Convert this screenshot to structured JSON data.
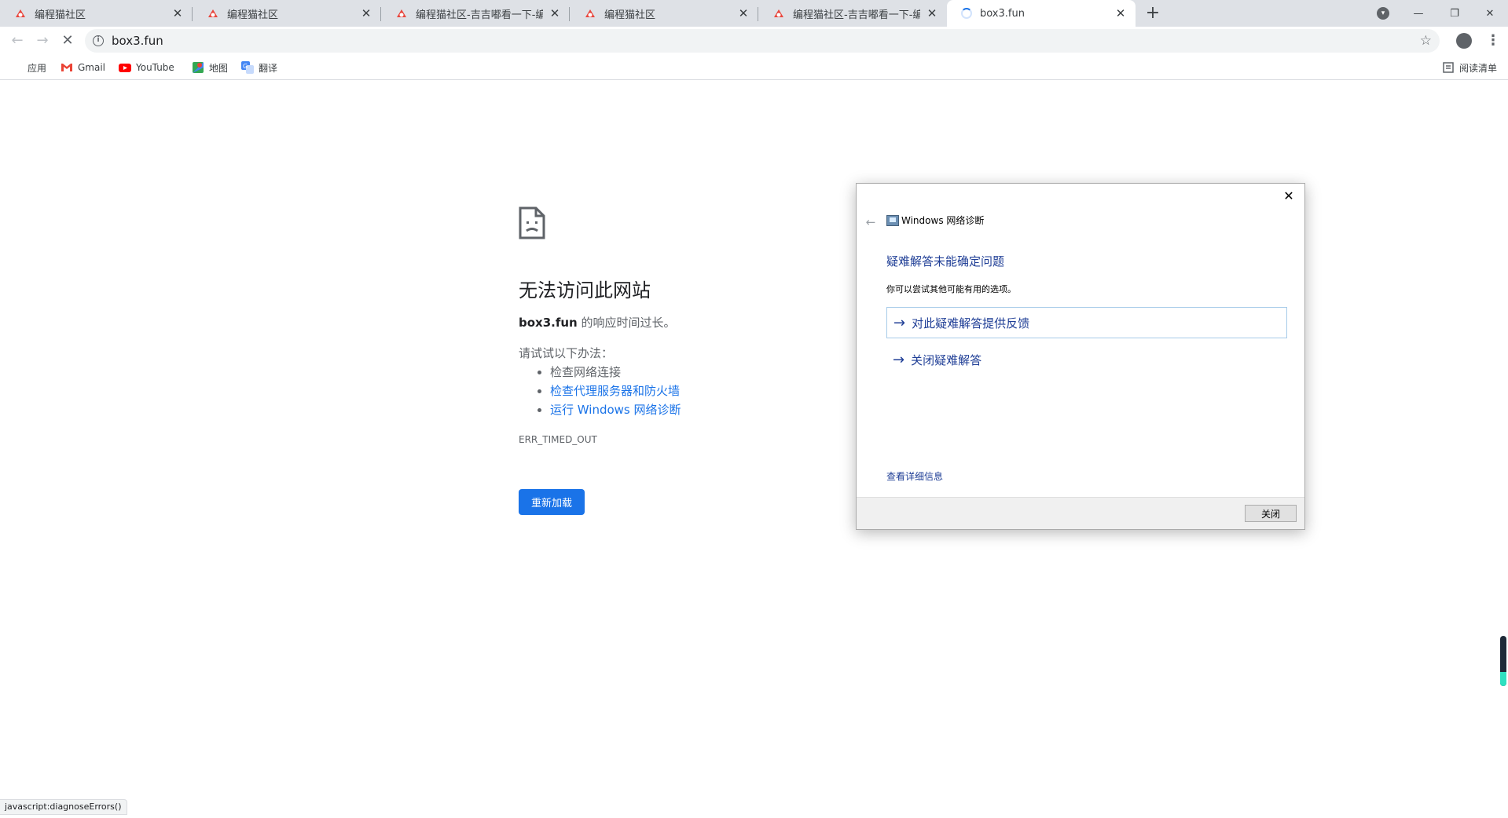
{
  "tabs": [
    {
      "title": "编程猫社区",
      "favicon": "codemao-icon"
    },
    {
      "title": "编程猫社区",
      "favicon": "codemao-icon"
    },
    {
      "title": "编程猫社区-吉吉嘟看一下-编程猫",
      "favicon": "codemao-icon"
    },
    {
      "title": "编程猫社区",
      "favicon": "codemao-icon"
    },
    {
      "title": "编程猫社区-吉吉嘟看一下-编程猫",
      "favicon": "codemao-icon"
    },
    {
      "title": "box3.fun",
      "favicon": "loading-spinner",
      "active": true
    }
  ],
  "toolbar": {
    "url": "box3.fun"
  },
  "bookmarks": {
    "items": [
      {
        "label": "应用",
        "icon": "apps-grid-icon"
      },
      {
        "label": "Gmail",
        "icon": "gmail-icon"
      },
      {
        "label": "YouTube",
        "icon": "youtube-icon"
      },
      {
        "label": "地图",
        "icon": "maps-icon"
      },
      {
        "label": "翻译",
        "icon": "translate-icon"
      }
    ],
    "reading_list": "阅读清单"
  },
  "error_page": {
    "title": "无法访问此网站",
    "host": "box3.fun",
    "summary_suffix": " 的响应时间过长。",
    "try_label": "请试试以下办法：",
    "suggestions": [
      "检查网络连接",
      "检查代理服务器和防火墙",
      "运行 Windows 网络诊断"
    ],
    "error_code": "ERR_TIMED_OUT",
    "reload_label": "重新加载"
  },
  "dialog": {
    "app_title": "Windows 网络诊断",
    "heading": "疑难解答未能确定问题",
    "text": "你可以尝试其他可能有用的选项。",
    "options": [
      "对此疑难解答提供反馈",
      "关闭疑难解答"
    ],
    "details_link": "查看详细信息",
    "close_button": "关闭"
  },
  "status_bar": {
    "text": "javascript:diagnoseErrors()"
  },
  "colors": {
    "accent": "#1a73e8",
    "dialog_link": "#1f3e96",
    "tabstrip": "#dee1e6"
  }
}
